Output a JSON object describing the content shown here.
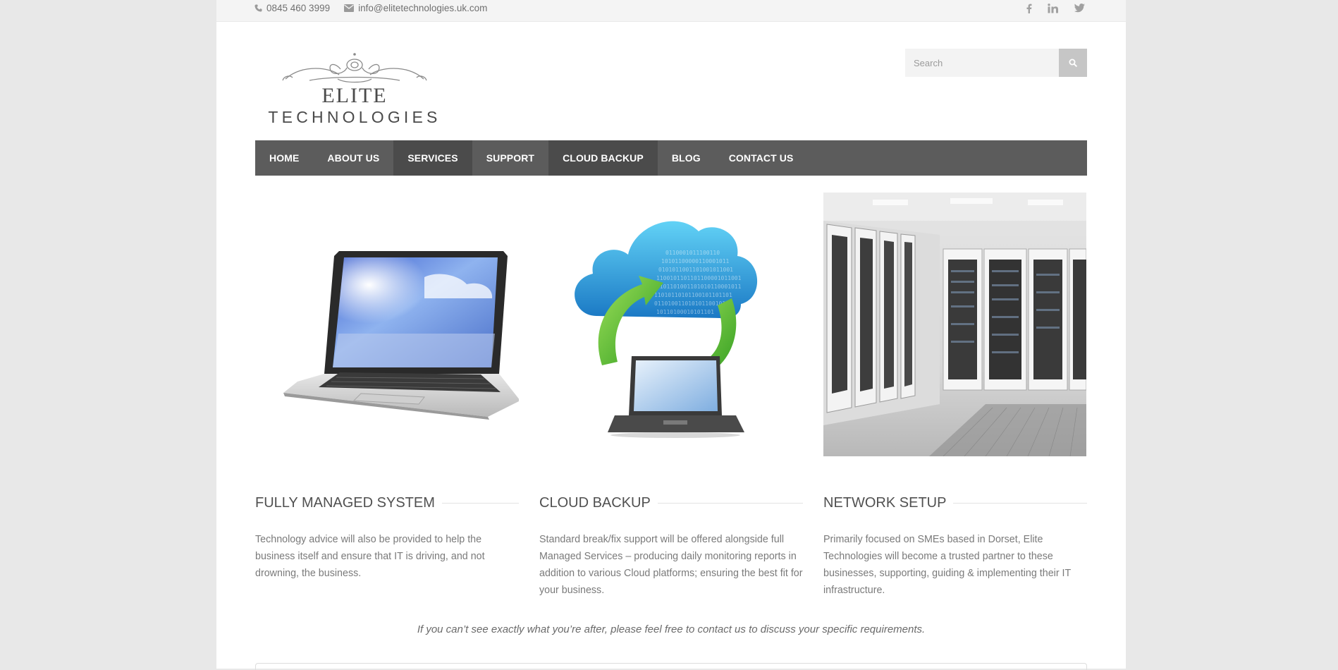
{
  "topbar": {
    "phone": "0845 460 3999",
    "email": "info@elitetechnologies.uk.com",
    "phone_icon": "phone-icon",
    "email_icon": "envelope-icon",
    "social_icons": [
      "facebook-icon",
      "linkedin-icon",
      "twitter-icon"
    ]
  },
  "logo": {
    "line1": "ELITE",
    "line2": "TECHNOLOGIES"
  },
  "search": {
    "placeholder": "Search",
    "icon": "search-icon"
  },
  "nav": {
    "items": [
      {
        "label": "HOME"
      },
      {
        "label": "ABOUT US"
      },
      {
        "label": "SERVICES"
      },
      {
        "label": "SUPPORT"
      },
      {
        "label": "CLOUD BACKUP"
      },
      {
        "label": "BLOG"
      },
      {
        "label": "CONTACT US"
      }
    ]
  },
  "features": [
    {
      "title": "FULLY MANAGED SYSTEM",
      "text": "Technology advice will also be provided to help the business itself and ensure that IT is driving, and not drowning, the business."
    },
    {
      "title": "CLOUD BACKUP",
      "text": "Standard break/fix support will be offered alongside full Managed Services – producing daily monitoring reports in addition to various Cloud platforms; ensuring the best fit for your business."
    },
    {
      "title": "NETWORK SETUP",
      "text": "Primarily focused on SMEs based in Dorset, Elite Technologies will become a trusted partner to these businesses, supporting, guiding & implementing their IT infrastructure."
    }
  ],
  "note": "If you can’t see exactly what you’re after, please feel free to contact us to discuss your specific requirements.",
  "colors": {
    "nav_bg": "#5c5c5c",
    "nav_active": "#4b4b4b",
    "page_bg": "#e8e8e8"
  }
}
